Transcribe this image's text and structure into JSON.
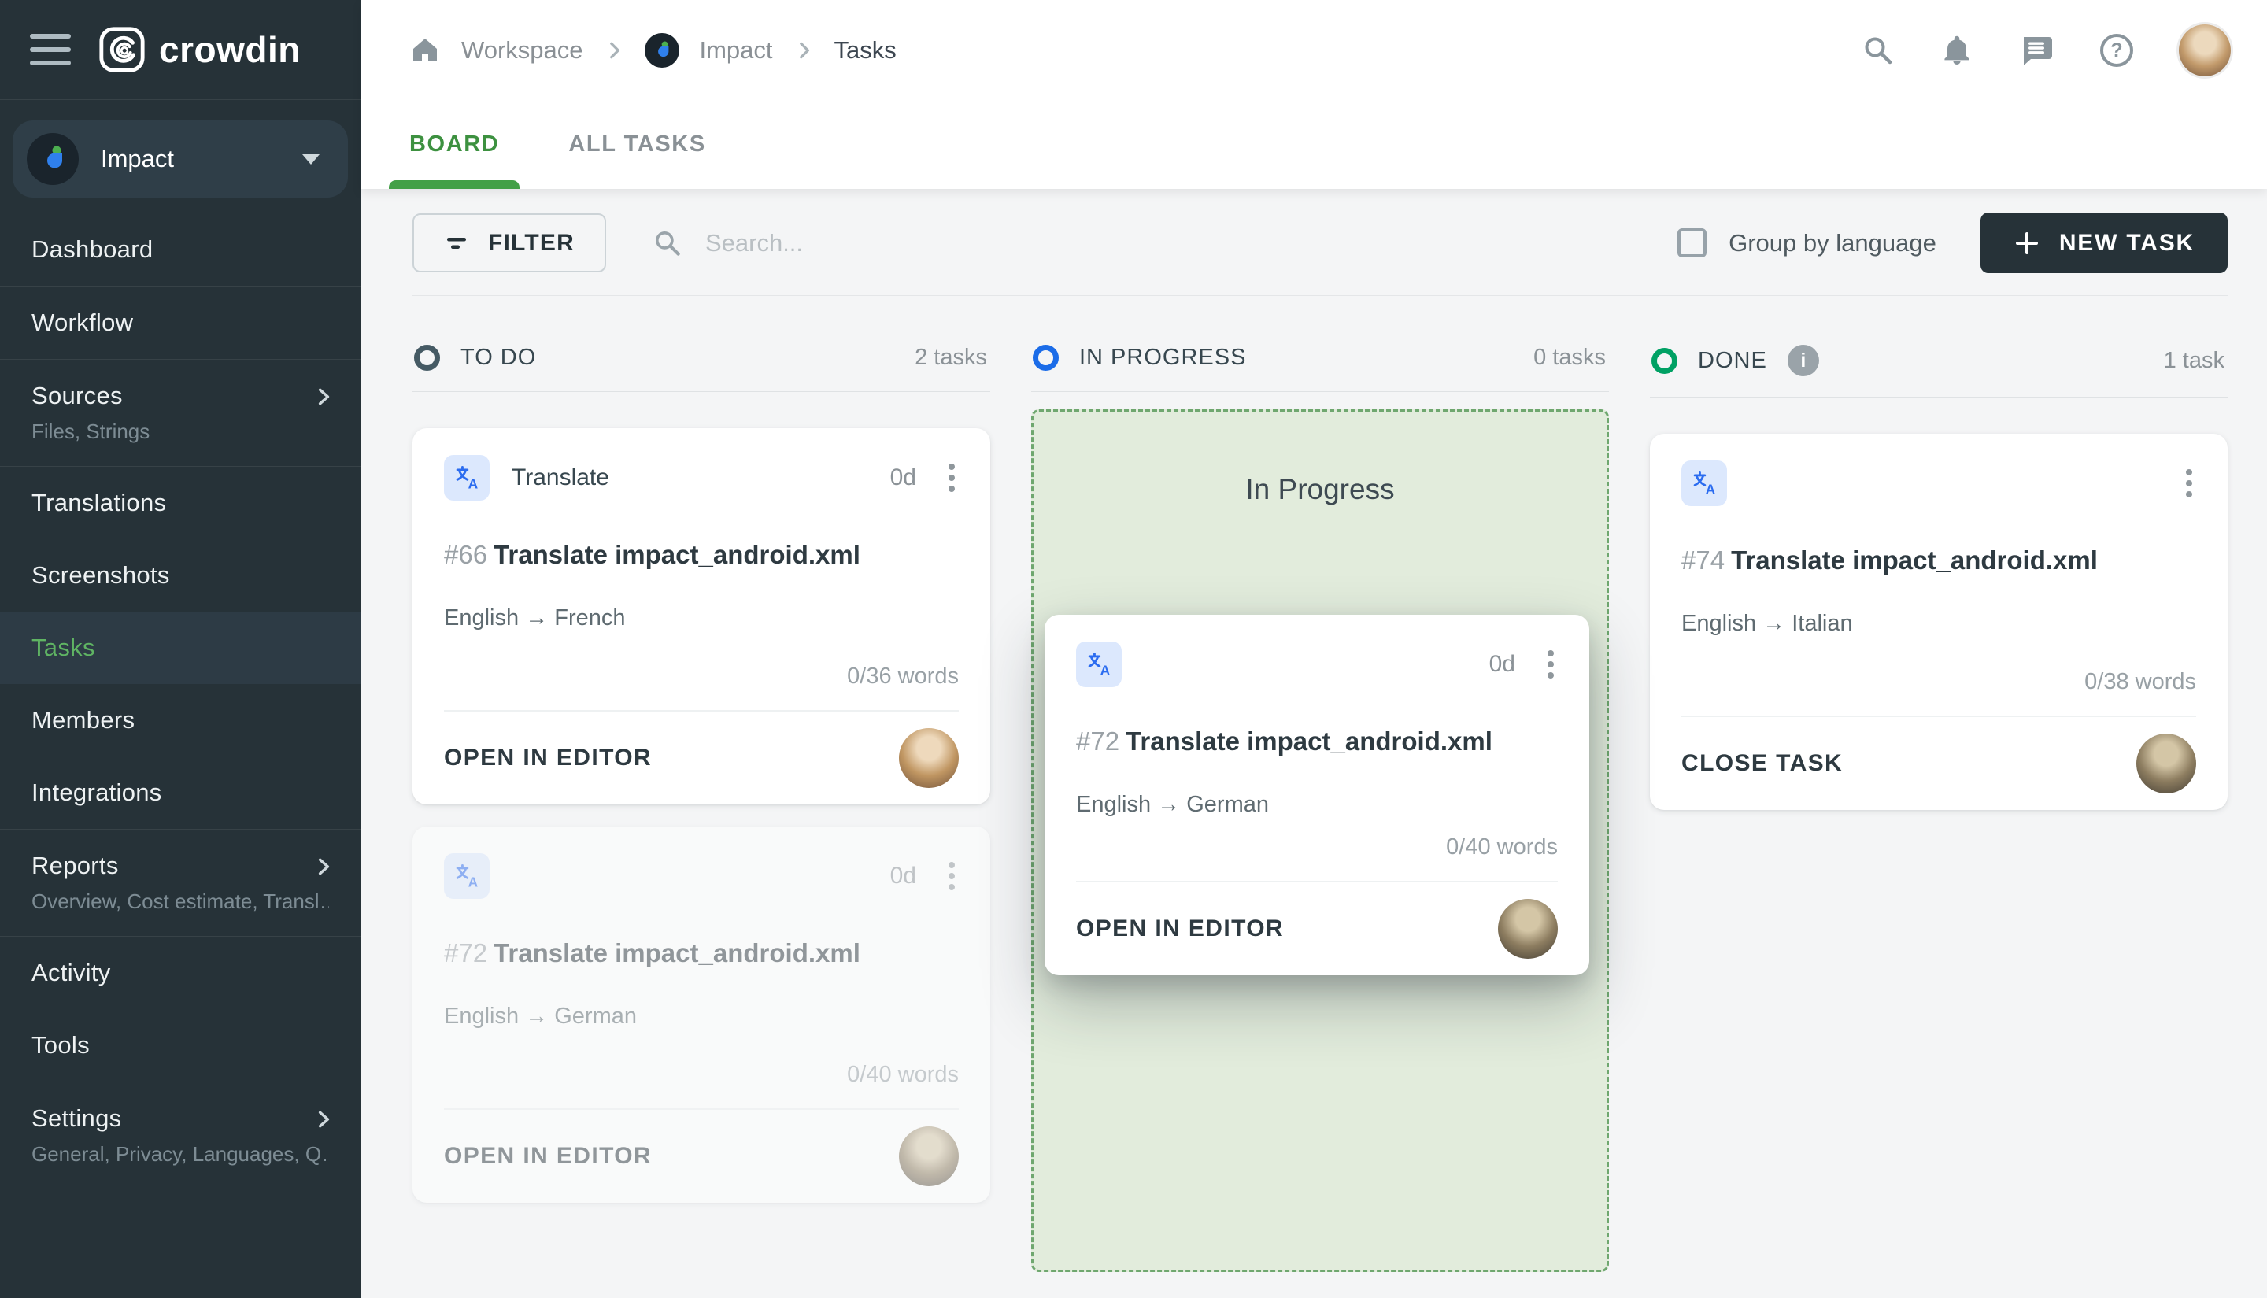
{
  "colors": {
    "sidebar_bg": "#263238",
    "accent_green": "#43a047",
    "todo_ring": "#455a64",
    "in_progress_ring": "#1b6ce8",
    "done_ring": "#00a164",
    "dropzone_bg": "#e2ecdc",
    "new_task_bg": "#263238",
    "translate_icon_bg": "#dce8fd",
    "translate_icon_fg": "#2b6cf0"
  },
  "icons": {
    "hamburger": "menu-icon",
    "logo": "crowdin-mark",
    "home": "home-icon",
    "search": "magnifier",
    "bell": "notifications",
    "chat": "messages",
    "help": "question-circle",
    "filter": "filter-lines",
    "plus": "plus",
    "kebab": "three-dots-vertical",
    "info": "i-circle",
    "translate": "translate-glyph"
  },
  "sidebar": {
    "logo_text": "crowdin",
    "project": {
      "name": "Impact"
    },
    "items": [
      {
        "label": "Dashboard"
      },
      {
        "label": "Workflow"
      },
      {
        "label": "Sources",
        "sublabel": "Files, Strings"
      },
      {
        "label": "Translations"
      },
      {
        "label": "Screenshots"
      },
      {
        "label": "Tasks"
      },
      {
        "label": "Members"
      },
      {
        "label": "Integrations"
      },
      {
        "label": "Reports",
        "sublabel": "Overview, Cost estimate, Transl…"
      },
      {
        "label": "Activity"
      },
      {
        "label": "Tools"
      },
      {
        "label": "Settings",
        "sublabel": "General, Privacy, Languages, Q…"
      }
    ]
  },
  "topbar": {
    "breadcrumb": {
      "workspace": "Workspace",
      "project": "Impact",
      "page": "Tasks"
    }
  },
  "tabs": {
    "board": "BOARD",
    "all_tasks": "ALL TASKS"
  },
  "toolbar": {
    "filter_label": "FILTER",
    "search_placeholder": "Search...",
    "group_by_language": "Group by language",
    "group_by_language_checked": false,
    "new_task": "NEW TASK"
  },
  "board": {
    "columns": [
      {
        "name": "TO DO",
        "count": "2 tasks",
        "color": "#455a64"
      },
      {
        "name": "IN PROGRESS",
        "count": "0 tasks",
        "color": "#1b6ce8",
        "dropzone_label": "In Progress"
      },
      {
        "name": "DONE",
        "count": "1 task",
        "color": "#00a164",
        "info": "i"
      }
    ],
    "cards": {
      "todo_1": {
        "type_label": "Translate",
        "duration": "0d",
        "id": "#66",
        "title": "Translate impact_android.xml",
        "languages": "English → French",
        "words": "0/36 words",
        "action": "OPEN IN EDITOR"
      },
      "todo_2": {
        "duration": "0d",
        "id": "#72",
        "title": "Translate impact_android.xml",
        "languages": "English → German",
        "words": "0/40 words",
        "action": "OPEN IN EDITOR"
      },
      "dragging": {
        "duration": "0d",
        "id": "#72",
        "title": "Translate impact_android.xml",
        "languages": "English → German",
        "words": "0/40 words",
        "action": "OPEN IN EDITOR"
      },
      "done_1": {
        "id": "#74",
        "title": "Translate impact_android.xml",
        "languages": "English → Italian",
        "words": "0/38 words",
        "action": "CLOSE TASK"
      }
    }
  }
}
